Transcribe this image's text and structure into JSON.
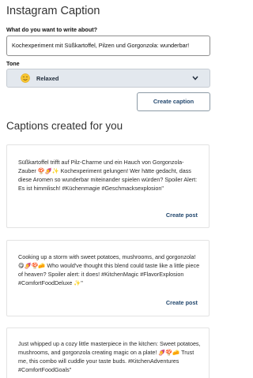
{
  "app": {
    "title": "Instagram Caption"
  },
  "form": {
    "topic_label": "What do you want to write about?",
    "topic_value": "Kochexperiment mit Süßkartoffel, Pilzen und Gorgonzola: wunderbar!",
    "tone_label": "Tone",
    "tone_value": "Relaxed",
    "tone_icon": "relaxed-face-emoji",
    "create_button": "Create caption"
  },
  "results": {
    "heading": "Captions created for you",
    "post_label": "Create post",
    "captions": [
      "Süßkartoffel trifft auf Pilz-Charme und ein Hauch von Gorgonzola-Zauber 🍄🍠✨ Kochexperiment gelungen! Wer hätte gedacht, dass diese Aromen so wunderbar miteinander spielen würden? Spoiler Alert: Es ist himmlisch! #Küchenmagie #Geschmacksexplosion\"",
      "Cooking up a storm with sweet potatoes, mushrooms, and gorgonzola! 😋🍠🍄🧀 Who would've thought this blend could taste like a little piece of heaven? Spoiler alert: it does! #KitchenMagic #FlavorExplosion #ComfortFoodDeluxe ✨\"",
      "Just whipped up a cozy little masterpiece in the kitchen: Sweet potatoes, mushrooms, and gorgonzola creating magic on a plate! 🍠🍄🧀 Trust me, this combo will cuddle your taste buds. #KitchenAdventures #ComfortFoodGoals\""
    ]
  },
  "colors": {
    "accent": "#23486e",
    "select_bg": "#e3e8ee"
  }
}
